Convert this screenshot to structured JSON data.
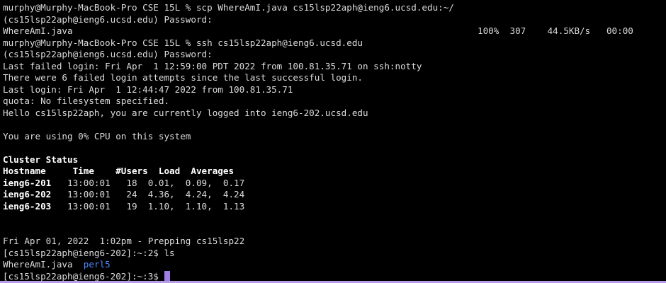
{
  "colors": {
    "background": "#000000",
    "text": "#dcdcdc",
    "directory": "#4d88ff",
    "cursor": "#a07fe6",
    "border": "#b79be6"
  },
  "terminal": {
    "lines": [
      "murphy@Murphy-MacBook-Pro CSE 15L % scp WhereAmI.java cs15lsp22aph@ieng6.ucsd.edu:~/",
      "(cs15lsp22aph@ieng6.ucsd.edu) Password:",
      "WhereAmI.java",
      "murphy@Murphy-MacBook-Pro CSE 15L % ssh cs15lsp22aph@ieng6.ucsd.edu",
      "(cs15lsp22aph@ieng6.ucsd.edu) Password:",
      "Last failed login: Fri Apr  1 12:59:00 PDT 2022 from 100.81.35.71 on ssh:notty",
      "There were 6 failed login attempts since the last successful login.",
      "Last login: Fri Apr  1 12:44:47 2022 from 100.81.35.71",
      "quota: No filesystem specified.",
      "Hello cs15lsp22aph, you are currently logged into ieng6-202.ucsd.edu",
      "",
      "You are using 0% CPU on this system",
      "",
      "Cluster Status",
      "Hostname     Time    #Users  Load  Averages",
      "ieng6-201   13:00:01   18  0.01,  0.09,  0.17",
      "ieng6-202   13:00:01   24  4.36,  4.24,  4.24",
      "ieng6-203   13:00:01   19  1.10,  1.10,  1.13",
      "",
      "",
      "Fri Apr 01, 2022  1:02pm - Prepping cs15lsp22",
      "[cs15lsp22aph@ieng6-202]:~:2$ ls",
      "WhereAmI.java  ",
      "[cs15lsp22aph@ieng6-202]:~:3$ "
    ],
    "scp_stats": "100%  307    44.5KB/s   00:00",
    "ls_directory": "perl5"
  }
}
